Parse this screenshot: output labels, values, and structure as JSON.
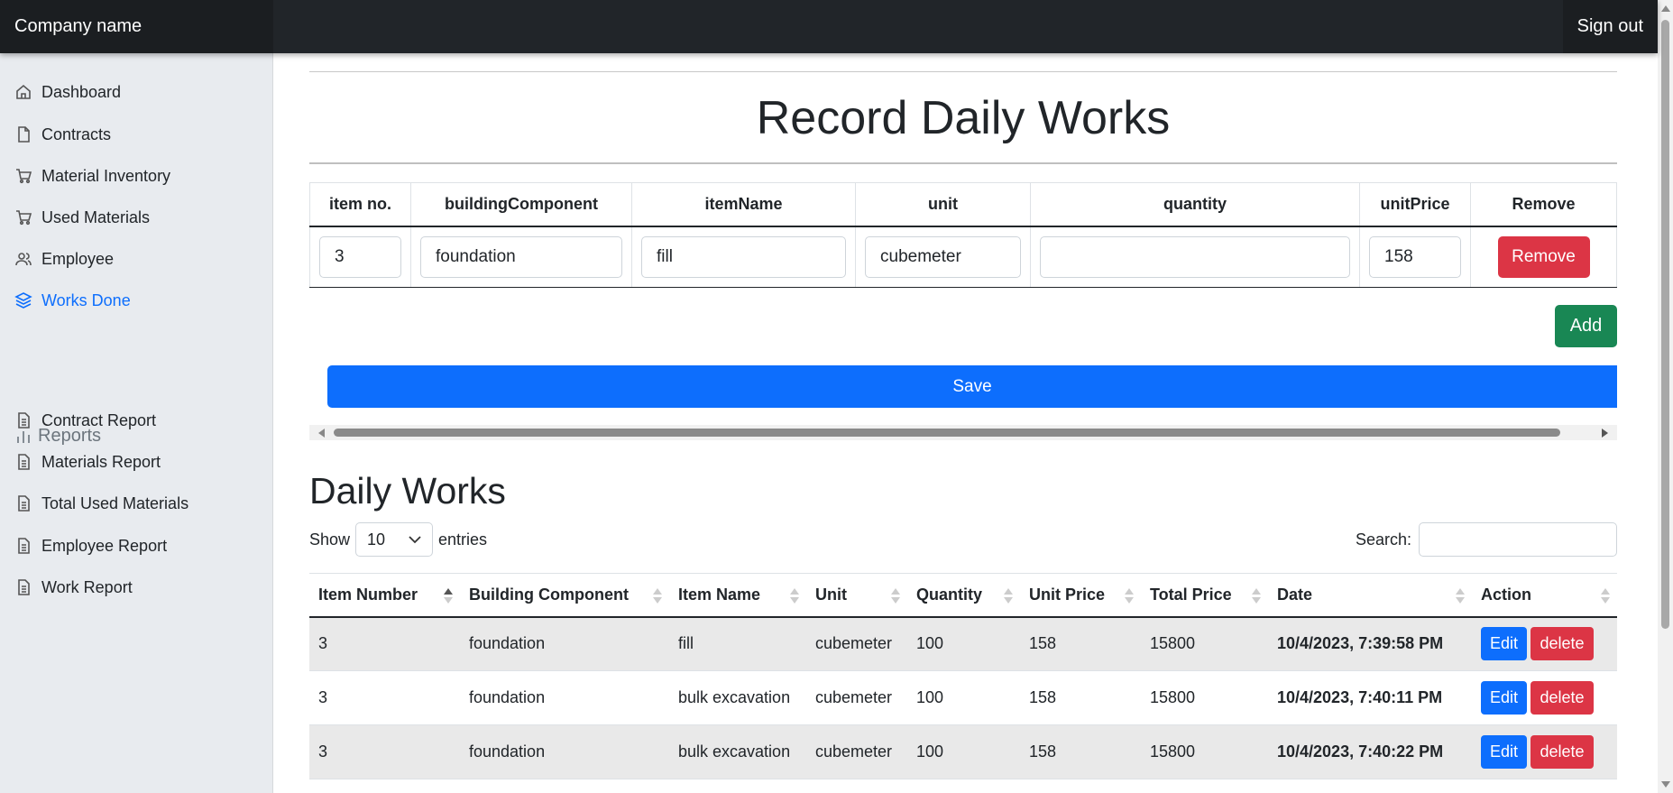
{
  "header": {
    "brand": "Company name",
    "signout": "Sign out"
  },
  "sidebar": {
    "items": [
      {
        "label": "Dashboard",
        "icon": "home-icon"
      },
      {
        "label": "Contracts",
        "icon": "file-icon"
      },
      {
        "label": "Material Inventory",
        "icon": "cart-icon"
      },
      {
        "label": "Used Materials",
        "icon": "cart-icon"
      },
      {
        "label": "Employee",
        "icon": "users-icon"
      },
      {
        "label": "Works Done",
        "icon": "layers-icon",
        "active": true
      }
    ],
    "reports_heading": "Reports",
    "reports": [
      {
        "label": "Contract Report"
      },
      {
        "label": "Materials Report"
      },
      {
        "label": "Total Used Materials"
      },
      {
        "label": "Employee Report"
      },
      {
        "label": "Work Report"
      }
    ]
  },
  "form": {
    "title": "Record Daily Works",
    "columns": [
      "item no.",
      "buildingComponent",
      "itemName",
      "unit",
      "quantity",
      "unitPrice",
      "Remove"
    ],
    "row": {
      "item_no": "3",
      "building_component": "foundation",
      "item_name": "fill",
      "unit": "cubemeter",
      "quantity": "",
      "unit_price": "158"
    },
    "remove_label": "Remove",
    "add_label": "Add",
    "save_label": "Save"
  },
  "daily_works": {
    "title": "Daily Works",
    "show_label": "Show",
    "entries_value": "10",
    "entries_label": "entries",
    "search_label": "Search:",
    "columns": [
      "Item Number",
      "Building Component",
      "Item Name",
      "Unit",
      "Quantity",
      "Unit Price",
      "Total Price",
      "Date",
      "Action"
    ],
    "rows": [
      {
        "item_number": "3",
        "building_component": "foundation",
        "item_name": "fill",
        "unit": "cubemeter",
        "quantity": "100",
        "unit_price": "158",
        "total_price": "15800",
        "date": "10/4/2023, 7:39:58 PM"
      },
      {
        "item_number": "3",
        "building_component": "foundation",
        "item_name": "bulk excavation",
        "unit": "cubemeter",
        "quantity": "100",
        "unit_price": "158",
        "total_price": "15800",
        "date": "10/4/2023, 7:40:11 PM"
      },
      {
        "item_number": "3",
        "building_component": "foundation",
        "item_name": "bulk excavation",
        "unit": "cubemeter",
        "quantity": "100",
        "unit_price": "158",
        "total_price": "15800",
        "date": "10/4/2023, 7:40:22 PM"
      }
    ],
    "edit_label": "Edit",
    "delete_label": "delete"
  },
  "colors": {
    "primary": "#0d6efd",
    "danger": "#dc3545",
    "success": "#198754",
    "header": "#212529",
    "sidebar": "#e8ebef"
  }
}
